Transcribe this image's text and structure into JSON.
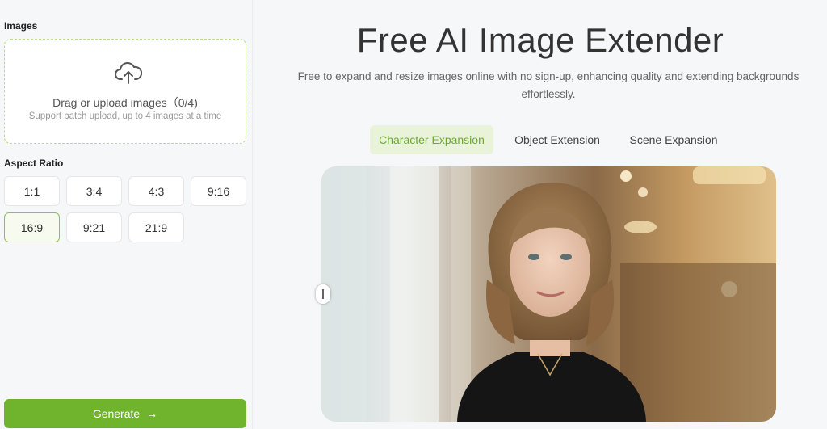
{
  "sidebar": {
    "images_label": "Images",
    "upload": {
      "title": "Drag or upload images（0/4)",
      "subtitle": "Support batch upload, up to 4 images at a time"
    },
    "aspect_label": "Aspect Ratio",
    "ratios": [
      "1:1",
      "3:4",
      "4:3",
      "9:16",
      "16:9",
      "9:21",
      "21:9"
    ],
    "selected_ratio": "16:9",
    "generate_label": "Generate",
    "generate_arrow": "→"
  },
  "main": {
    "title": "Free AI Image Extender",
    "subtitle": "Free to expand and resize images online with no sign-up, enhancing quality and extending backgrounds effortlessly.",
    "tabs": [
      {
        "label": "Character Expansion",
        "active": true
      },
      {
        "label": "Object Extension",
        "active": false
      },
      {
        "label": "Scene Expansion",
        "active": false
      }
    ]
  },
  "colors": {
    "accent": "#6fb42c",
    "accent_light": "#e9f3da",
    "upload_border": "#b9dd7e"
  },
  "icons": [
    "cloud-upload-icon",
    "arrow-right-icon"
  ]
}
